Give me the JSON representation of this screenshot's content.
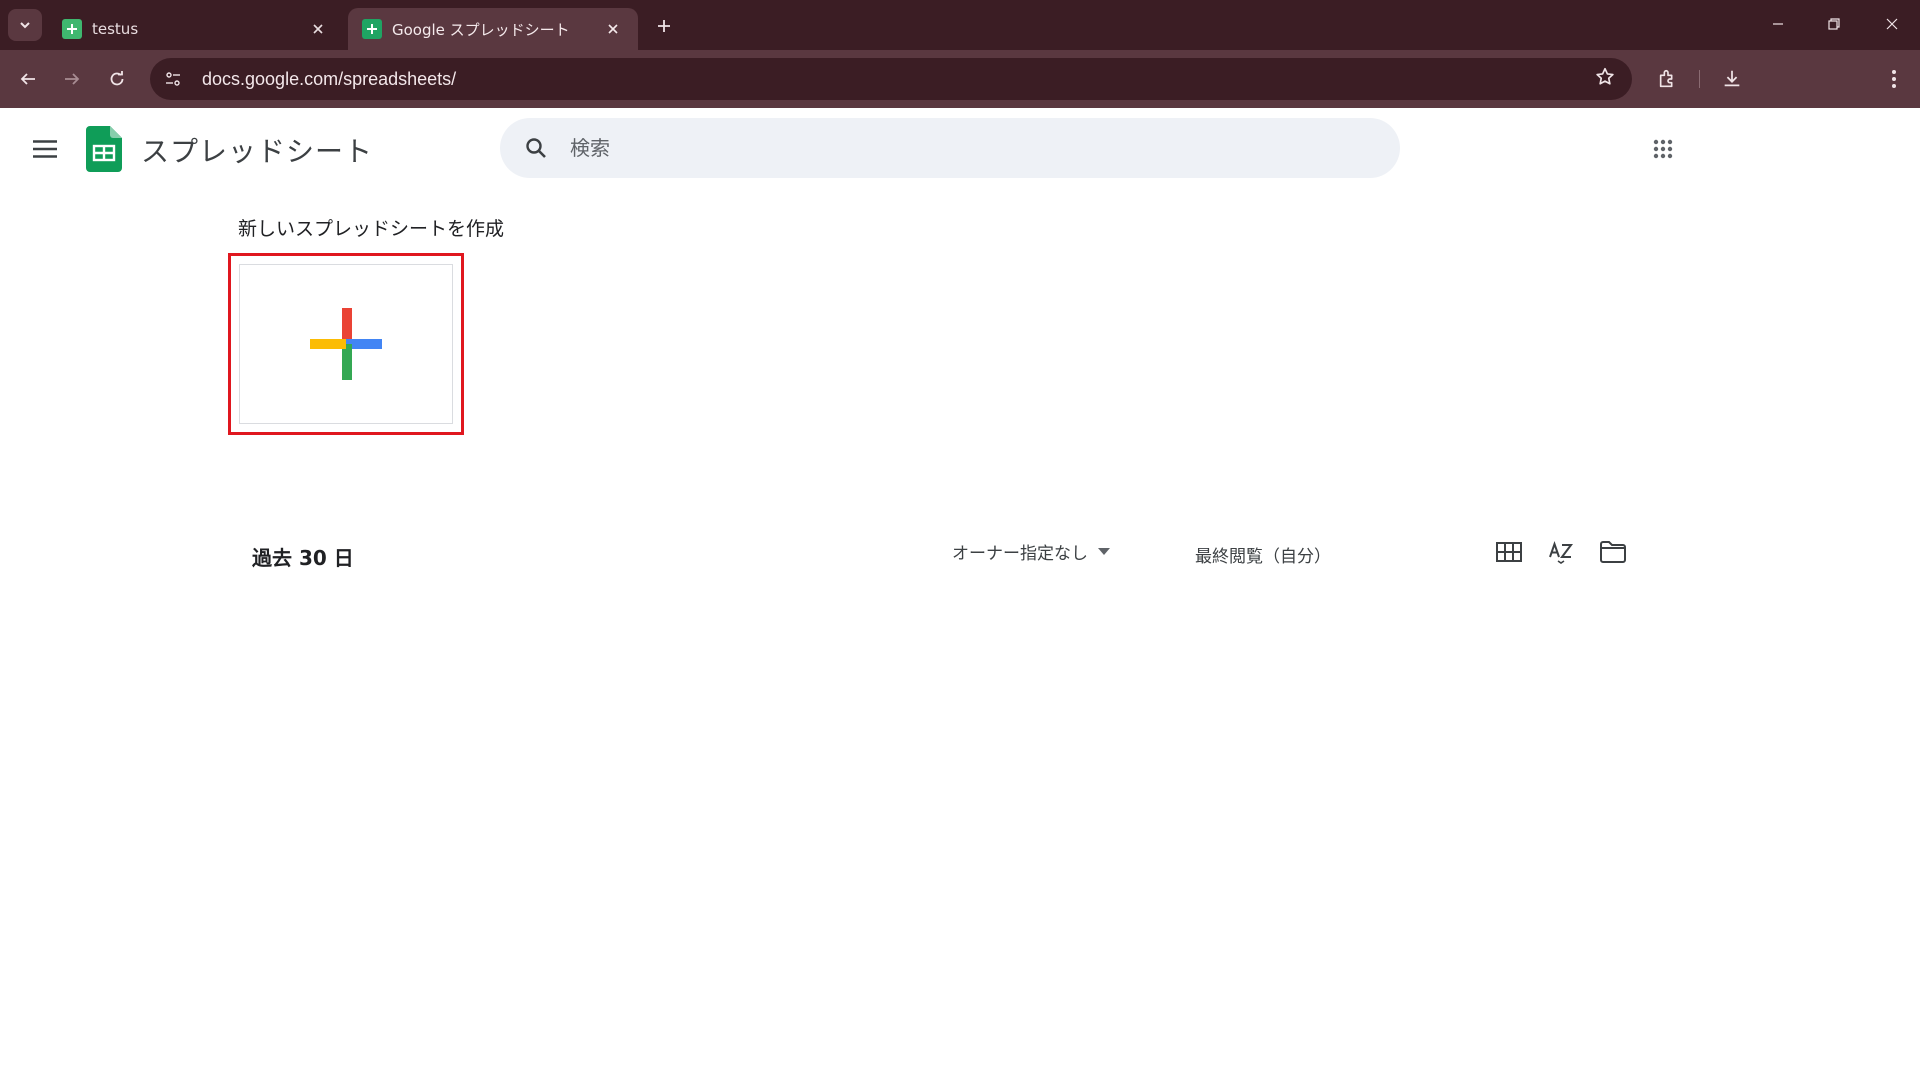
{
  "browser": {
    "tabs": [
      {
        "title": "testus",
        "active": false
      },
      {
        "title": "Google スプレッドシート",
        "active": true
      }
    ],
    "url": "docs.google.com/spreadsheets/"
  },
  "app": {
    "title": "スプレッドシート",
    "search_placeholder": "検索"
  },
  "templates": {
    "heading": "新しいスプレッドシートを作成"
  },
  "recent": {
    "label": "過去 30 日",
    "owner_filter": "オーナー指定なし",
    "sort_label": "最終閲覧（自分）"
  },
  "colors": {
    "chrome_dark": "#3b1d24",
    "chrome_mid": "#5a3840",
    "sheets_green": "#0f9d58",
    "highlight_red": "#e0171f"
  }
}
